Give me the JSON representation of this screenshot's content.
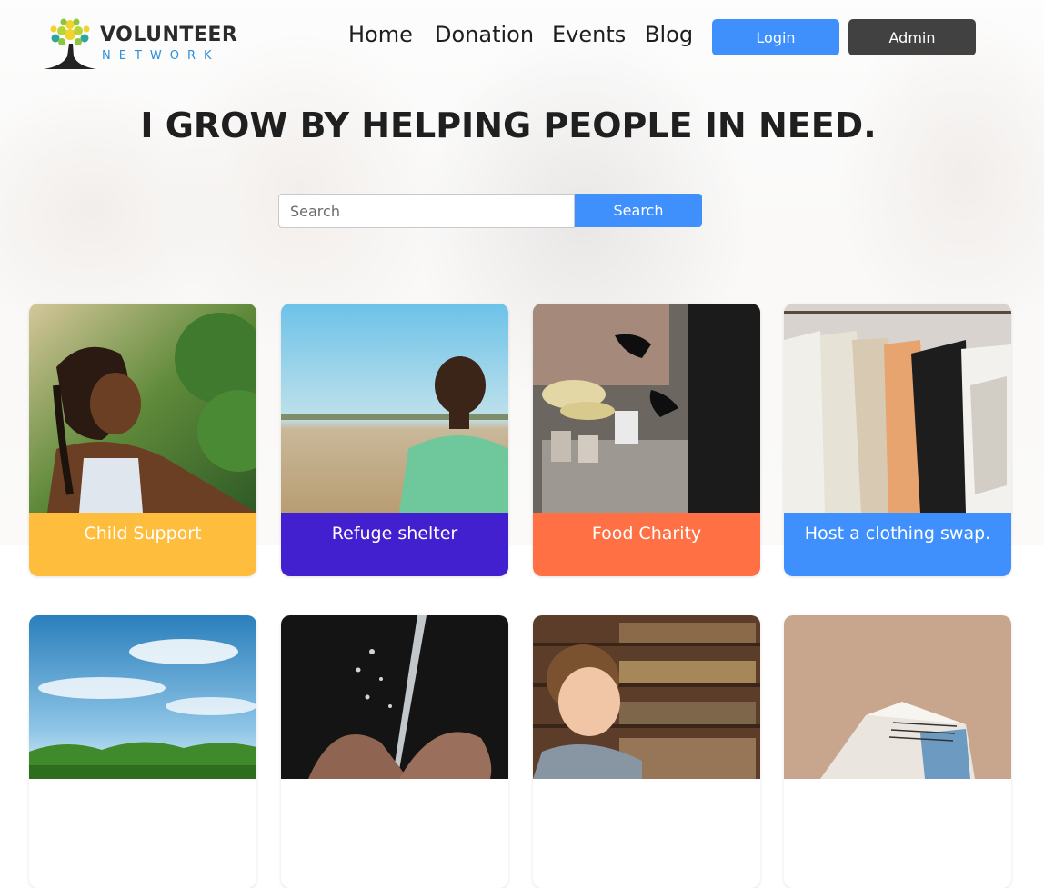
{
  "brand": {
    "title": "VOLUNTEER",
    "subtitle": "NETWORK",
    "logo_icon": "tree-logo-icon"
  },
  "nav": {
    "links": [
      {
        "label": "Home"
      },
      {
        "label": "Donation"
      },
      {
        "label": "Events"
      },
      {
        "label": "Blog"
      }
    ],
    "login_label": "Login",
    "admin_label": "Admin"
  },
  "hero": {
    "headline": "I GROW BY HELPING PEOPLE IN NEED."
  },
  "search": {
    "placeholder": "Search",
    "value": "",
    "button_label": "Search"
  },
  "colors": {
    "primary": "#3f90fc",
    "dark": "#414141",
    "card_yellow": "#ffbd3e",
    "card_purple": "#421fcf",
    "card_orange": "#ff7044",
    "card_blue": "#3f90fc"
  },
  "events": [
    {
      "title": "Child Support",
      "color": "#ffbd3e",
      "image": "smiling-girl-photo"
    },
    {
      "title": "Refuge shelter",
      "color": "#421fcf",
      "image": "boy-in-field-photo"
    },
    {
      "title": "Food Charity",
      "color": "#ff7044",
      "image": "food-table-photo"
    },
    {
      "title": "Host a clothing swap.",
      "color": "#3f90fc",
      "image": "clothing-rack-photo"
    },
    {
      "title": "",
      "image": "sky-trees-photo"
    },
    {
      "title": "",
      "image": "water-hands-photo"
    },
    {
      "title": "",
      "image": "boy-library-photo"
    },
    {
      "title": "",
      "image": "open-book-photo"
    }
  ]
}
